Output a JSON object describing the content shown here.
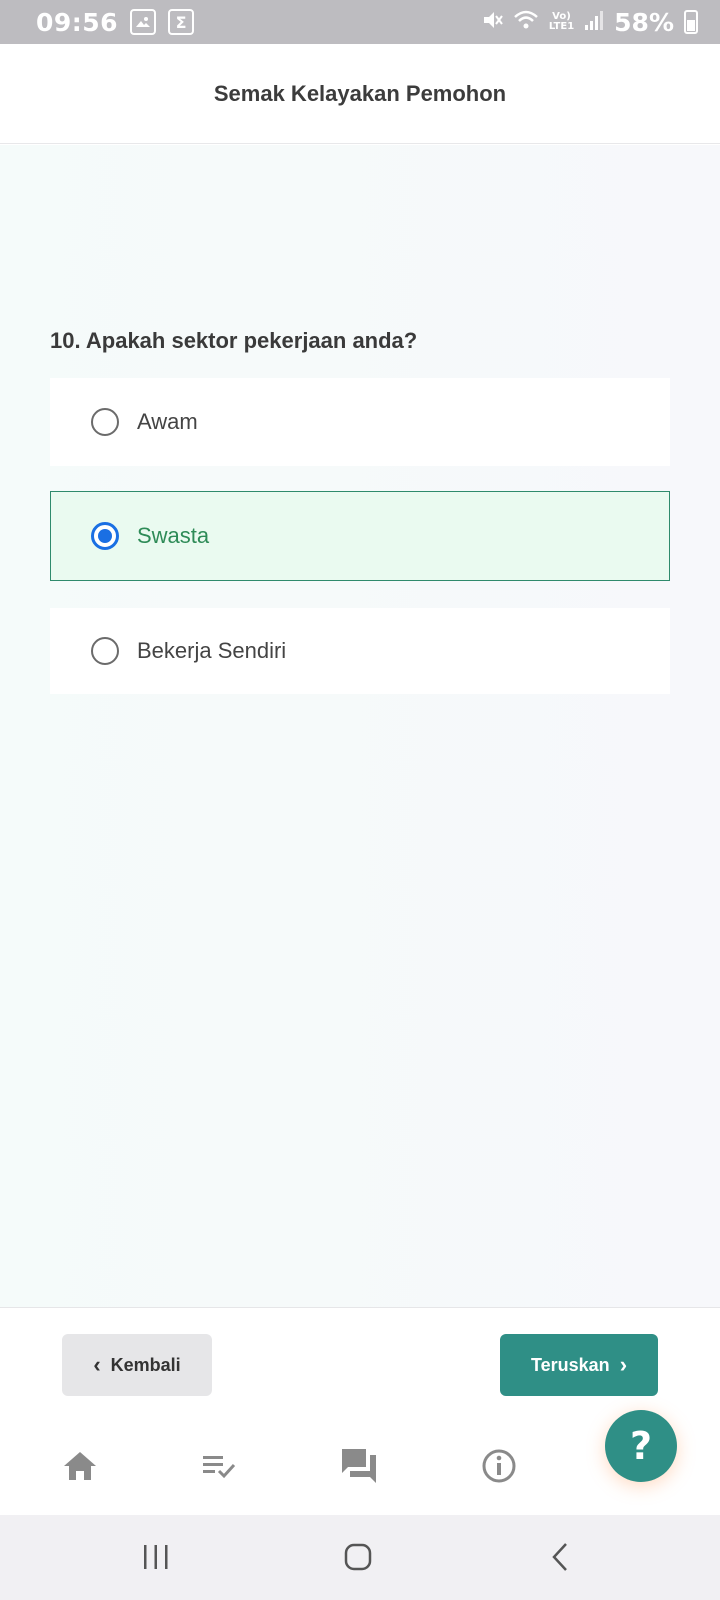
{
  "status_bar": {
    "time": "09:56",
    "battery": "58%"
  },
  "header": {
    "title": "Semak Kelayakan Pemohon"
  },
  "question": {
    "text": "10. Apakah sektor pekerjaan anda?",
    "options": [
      {
        "label": "Awam",
        "selected": false
      },
      {
        "label": "Swasta",
        "selected": true
      },
      {
        "label": "Bekerja Sendiri",
        "selected": false
      }
    ]
  },
  "actions": {
    "back_label": "Kembali",
    "next_label": "Teruskan"
  },
  "bottom_nav": {
    "items": [
      "home-icon",
      "checklist-icon",
      "chat-icon",
      "info-icon"
    ]
  },
  "help_fab": {
    "label": "?"
  },
  "colors": {
    "primary": "#2f8f86",
    "selected_bg": "#eafaf0",
    "selected_border": "#2f8a6c",
    "selected_text": "#2e8b57",
    "radio_checked": "#1a6fe3"
  }
}
